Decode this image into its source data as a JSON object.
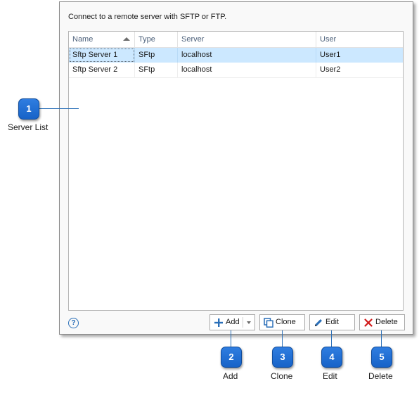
{
  "intro": "Connect to a remote server with SFTP or FTP.",
  "list": {
    "columns": [
      {
        "label": "Name",
        "sorted": "ascending"
      },
      {
        "label": "Type"
      },
      {
        "label": "Server"
      },
      {
        "label": "User"
      }
    ],
    "rows": [
      {
        "name": "Sftp Server 1",
        "type": "SFtp",
        "server": "localhost",
        "user": "User1",
        "selected": true
      },
      {
        "name": "Sftp Server 2",
        "type": "SFtp",
        "server": "localhost",
        "user": "User2",
        "selected": false
      }
    ]
  },
  "help_icon": "?",
  "buttons": {
    "add": "Add",
    "clone": "Clone",
    "edit": "Edit",
    "delete": "Delete"
  },
  "callouts": [
    {
      "number": "1",
      "label": "Server List"
    },
    {
      "number": "2",
      "label": "Add"
    },
    {
      "number": "3",
      "label": "Clone"
    },
    {
      "number": "4",
      "label": "Edit"
    },
    {
      "number": "5",
      "label": "Delete"
    }
  ],
  "icons": {
    "help": "question-circle-icon",
    "add": "plus-icon",
    "clone": "clone-icon",
    "edit": "pencil-icon",
    "delete": "x-icon"
  },
  "colors": {
    "selection": "#cce8ff",
    "callout": "#1f6fd6",
    "delete_x": "#d11a1a",
    "icon_blue": "#2a6fb8"
  }
}
